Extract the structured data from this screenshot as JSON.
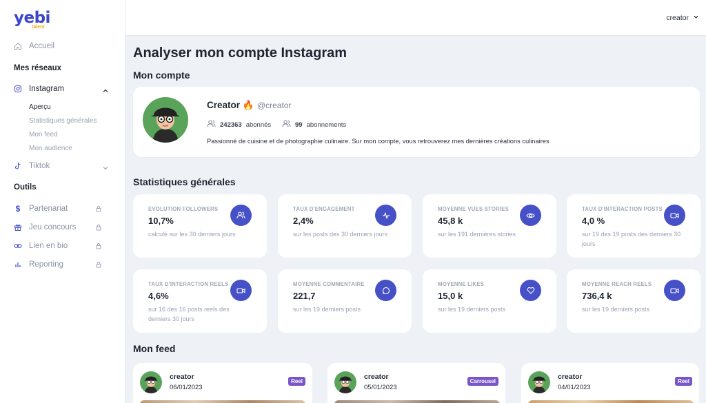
{
  "brand": {
    "name": "yebi",
    "sub": "talent"
  },
  "sidebar": {
    "home": "Accueil",
    "networks_title": "Mes réseaux",
    "instagram": "Instagram",
    "instagram_sub": [
      "Aperçu",
      "Statistiques générales",
      "Mon feed",
      "Mon audience"
    ],
    "tiktok": "Tiktok",
    "tools_title": "Outils",
    "tools": [
      "Partenariat",
      "Jeu concours",
      "Lien en bio",
      "Reporting"
    ]
  },
  "topbar": {
    "user": "creator"
  },
  "page": {
    "title": "Analyser mon compte Instagram",
    "account_title": "Mon compte",
    "stats_title": "Statistiques générales",
    "feed_title": "Mon feed"
  },
  "profile": {
    "name": "Creator 🔥",
    "handle": "@creator",
    "followers_count": "242363",
    "followers_label": "abonnés",
    "following_count": "99",
    "following_label": "abonnements",
    "bio": "Passionné de cuisine et de photographie culinaire. Sur mon compte, vous retrouverez mes dernières créations culinaires"
  },
  "stats": [
    {
      "label": "EVOLUTION FOLLOWERS",
      "value": "10,7%",
      "sub": "calculé sur les 30 derniers jours",
      "icon": "users-icon"
    },
    {
      "label": "TAUX D'ENGAGEMENT",
      "value": "2,4%",
      "sub": "sur les posts des 30 derniers jours",
      "icon": "activity-icon"
    },
    {
      "label": "MOYENNE VUES STORIES",
      "value": "45,8 k",
      "sub": "sur les 191 dernières stories",
      "icon": "eye-icon"
    },
    {
      "label": "TAUX D'INTERACTION POSTS",
      "value": "4,0 %",
      "sub": "sur 19 des 19 posts des derniers 30 jours",
      "icon": "video-icon"
    },
    {
      "label": "TAUX D'INTERACTION REELS",
      "value": "4,6%",
      "sub": "sur 16 des 16 posts reels des derniers 30 jours",
      "icon": "video-icon"
    },
    {
      "label": "MOYENNE COMMENTAIRE",
      "value": "221,7",
      "sub": "sur les 19 derniers posts",
      "icon": "comment-icon"
    },
    {
      "label": "MOYENNE LIKES",
      "value": "15,0 k",
      "sub": "sur les 19 derniers posts",
      "icon": "heart-icon"
    },
    {
      "label": "MOYENNE REACH REELS",
      "value": "736,4 k",
      "sub": "sur les 19 derniers posts",
      "icon": "video-icon"
    }
  ],
  "feed": [
    {
      "user": "creator",
      "date": "06/01/2023",
      "badge": "Reel"
    },
    {
      "user": "creator",
      "date": "05/01/2023",
      "badge": "Carrousel"
    },
    {
      "user": "creator",
      "date": "04/01/2023",
      "badge": "Reel"
    }
  ],
  "colors": {
    "accent": "#4650c7",
    "badge": "#7a55c9",
    "logo": "#3b46c9",
    "logo_sub": "#f2b218"
  }
}
